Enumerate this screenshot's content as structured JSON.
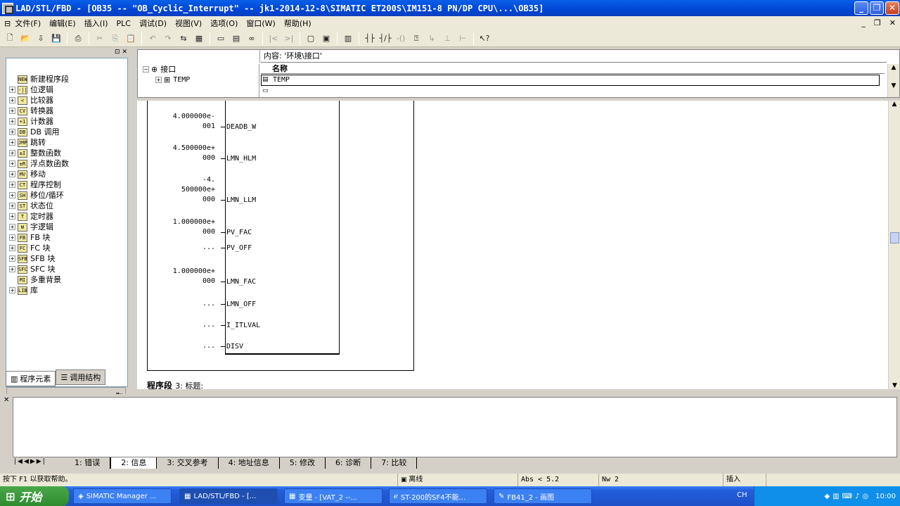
{
  "window": {
    "title": "LAD/STL/FBD  - [OB35 -- \"OB_Cyclic_Interrupt\" -- jk1-2014-12-8\\SIMATIC ET200S\\IM151-8 PN/DP CPU\\...\\OB35]"
  },
  "menu": {
    "items": [
      "文件(F)",
      "编辑(E)",
      "插入(I)",
      "PLC",
      "调试(D)",
      "视图(V)",
      "选项(O)",
      "窗口(W)",
      "帮助(H)"
    ]
  },
  "tree": {
    "items": [
      {
        "label": "新建程序段",
        "icon": "NEW",
        "expand": ""
      },
      {
        "label": "位逻辑",
        "icon": "-||",
        "expand": "+"
      },
      {
        "label": "比较器",
        "icon": "<",
        "expand": "+"
      },
      {
        "label": "转换器",
        "icon": "CV",
        "expand": "+"
      },
      {
        "label": "计数器",
        "icon": "+1",
        "expand": "+"
      },
      {
        "label": "DB 调用",
        "icon": "DB",
        "expand": "+"
      },
      {
        "label": "跳转",
        "icon": "JMP",
        "expand": "+"
      },
      {
        "label": "整数函数",
        "icon": "±I",
        "expand": "+"
      },
      {
        "label": "浮点数函数",
        "icon": "±R",
        "expand": "+"
      },
      {
        "label": "移动",
        "icon": "MV",
        "expand": "+"
      },
      {
        "label": "程序控制",
        "icon": "CT",
        "expand": "+"
      },
      {
        "label": "移位/循环",
        "icon": "SH",
        "expand": "+"
      },
      {
        "label": "状态位",
        "icon": "ST",
        "expand": "+"
      },
      {
        "label": "定时器",
        "icon": "T",
        "expand": "+"
      },
      {
        "label": "字逻辑",
        "icon": "W",
        "expand": "+"
      },
      {
        "label": "FB 块",
        "icon": "FB",
        "expand": "+"
      },
      {
        "label": "FC 块",
        "icon": "FC",
        "expand": "+"
      },
      {
        "label": "SFB 块",
        "icon": "SFB",
        "expand": "+"
      },
      {
        "label": "SFC 块",
        "icon": "SFC",
        "expand": "+"
      },
      {
        "label": "多重背景",
        "icon": "MI",
        "expand": ""
      },
      {
        "label": "库",
        "icon": "LIB",
        "expand": "+"
      }
    ]
  },
  "left_tabs": {
    "elements": "程序元素",
    "structure": "调用结构"
  },
  "interface": {
    "header": "内容: '环境\\接口'",
    "root": "接口",
    "child": "TEMP",
    "col_name": "名称",
    "row1": "TEMP"
  },
  "pins": [
    {
      "value": "4.000000e-\n001",
      "name": "DEADB_W"
    },
    {
      "value": "4.500000e+\n000",
      "name": "LMN_HLM"
    },
    {
      "value": "-4.\n500000e+\n000",
      "name": "LMN_LLM"
    },
    {
      "value": "1.000000e+\n000",
      "name": "PV_FAC"
    },
    {
      "value": "...",
      "name": "PV_OFF"
    },
    {
      "value": "1.000000e+\n000",
      "name": "LMN_FAC"
    },
    {
      "value": "...",
      "name": "LMN_OFF"
    },
    {
      "value": "...",
      "name": "I_ITLVAL"
    },
    {
      "value": "...",
      "name": "DISV"
    }
  ],
  "next_network": {
    "label": "程序段",
    "number": "3",
    "title": ": 标题:"
  },
  "bottom_tabs": [
    "1: 错误",
    "2: 信息",
    "3: 交叉参考",
    "4: 地址信息",
    "5: 修改",
    "6: 诊断",
    "7: 比较"
  ],
  "status": {
    "help": "按下 F1 以获取帮助。",
    "mode": "离线",
    "abs": "Abs < 5.2",
    "nw": "Nw 2",
    "insert": "插入"
  },
  "taskbar": {
    "start": "开始",
    "items": [
      "SIMATIC Manager ...",
      "LAD/STL/FBD  - [...",
      "变量 - [VAT_2 --...",
      "ST-200的SF4不能...",
      "FB41_2 - 画图"
    ],
    "lang": "CH",
    "clock": "10:00"
  }
}
